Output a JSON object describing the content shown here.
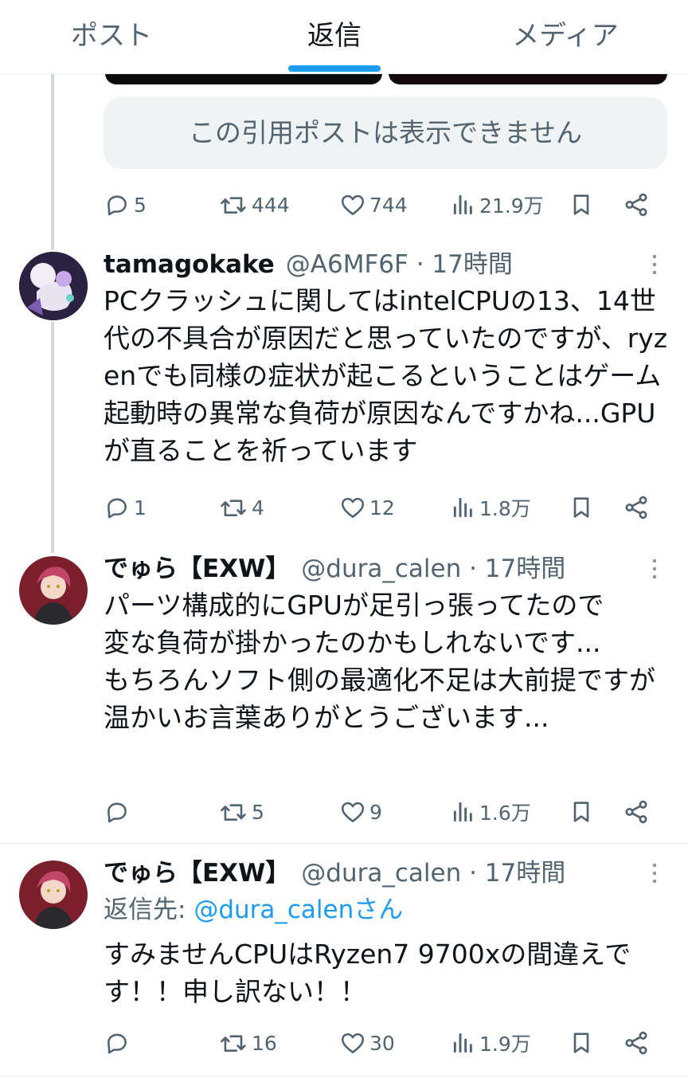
{
  "tabs": [
    {
      "label": "ポスト",
      "active": false
    },
    {
      "label": "返信",
      "active": true
    },
    {
      "label": "メディア",
      "active": false
    }
  ],
  "accent_color": "#1d9bf0",
  "quote_unavailable": "この引用ポストは表示できません",
  "top_post": {
    "stats": {
      "replies": "5",
      "reposts": "444",
      "likes": "744",
      "views": "21.9万"
    }
  },
  "posts": [
    {
      "display_name": "tamagokake",
      "handle_time": "@A6MF6F · 17時間",
      "text": "PCクラッシュに関してはintelCPUの13、14世代の不具合が原因だと思っていたのですが、ryzenでも同様の症状が起こるということはゲーム起動時の異常な負荷が原因なんですかね...GPUが直ることを祈っています",
      "stats": {
        "replies": "1",
        "reposts": "4",
        "likes": "12",
        "views": "1.8万"
      }
    },
    {
      "display_name": "でゅら【EXW】",
      "handle_time": "@dura_calen · 17時間",
      "text": "パーツ構成的にGPUが足引っ張ってたので\n変な負荷が掛かったのかもしれないです...\nもちろんソフト側の最適化不足は大前提ですが\n温かいお言葉ありがとうございます...",
      "stats": {
        "replies": "",
        "reposts": "5",
        "likes": "9",
        "views": "1.6万"
      }
    },
    {
      "display_name": "でゅら【EXW】",
      "handle_time": "@dura_calen · 17時間",
      "reply_to_prefix": "返信先: ",
      "reply_to_handle": "@dura_calenさん",
      "text": "すみませんCPUはRyzen7 9700xの間違えです！！申し訳ない！！",
      "stats": {
        "replies": "",
        "reposts": "16",
        "likes": "30",
        "views": "1.9万"
      }
    }
  ]
}
